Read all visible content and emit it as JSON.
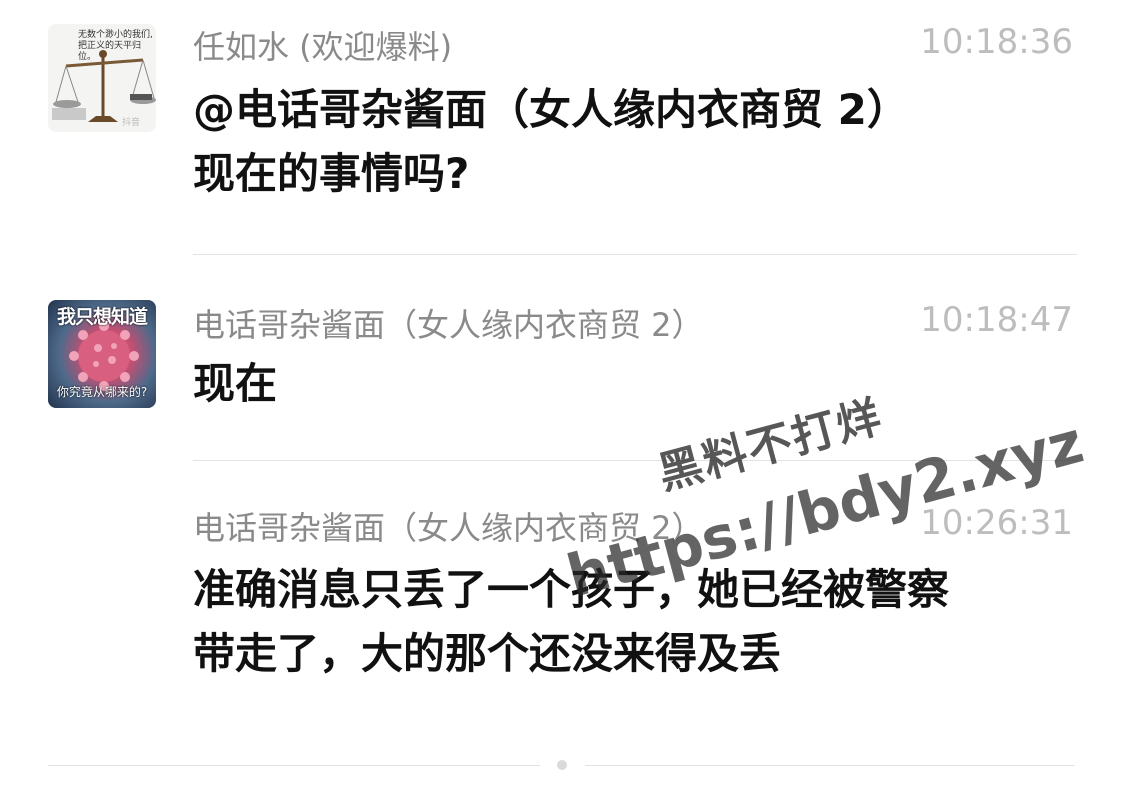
{
  "messages": [
    {
      "sender": "任如水 (欢迎爆料)",
      "time": "10:18:36",
      "lines": [
        "@电话哥杂酱面（女人缘内衣商贸 2）",
        "现在的事情吗?"
      ],
      "avatar_text": [
        "无数个渺小的我们,",
        "把正义的天平归位。"
      ],
      "avatar_watermark": "抖音"
    },
    {
      "sender": "电话哥杂酱面（女人缘内衣商贸 2）",
      "time": "10:18:47",
      "lines": [
        "现在"
      ],
      "avatar_top": "我只想知道",
      "avatar_bottom": "你究竟从哪来的?"
    },
    {
      "sender": "电话哥杂酱面（女人缘内衣商贸 2）",
      "time": "10:26:31",
      "lines": [
        "准确消息只丢了一个孩子，她已经被警察",
        "带走了，大的那个还没来得及丢"
      ]
    }
  ],
  "watermark": {
    "line1": "黑料不打烊",
    "line2": "https://bdy2.xyz"
  }
}
